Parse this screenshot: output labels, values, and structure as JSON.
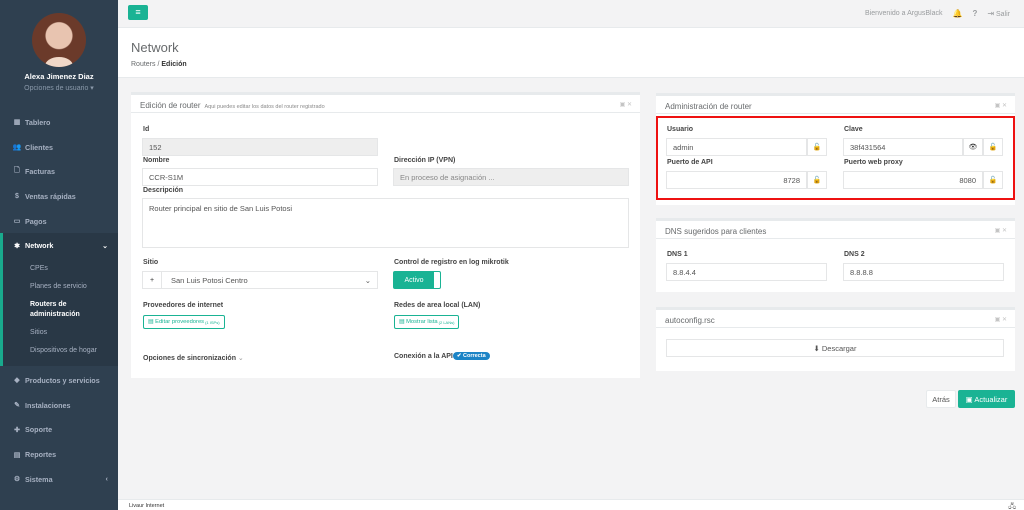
{
  "user": {
    "name": "Alexa Jimenez Diaz",
    "options": "Opciones de usuario ▾"
  },
  "nav": [
    {
      "label": "Tablero",
      "icon": "▦"
    },
    {
      "label": "Clientes",
      "icon": "👥"
    },
    {
      "label": "Facturas",
      "icon": "🗋"
    },
    {
      "label": "Ventas rápidas",
      "icon": "$"
    },
    {
      "label": "Pagos",
      "icon": "▭"
    },
    {
      "label": "Network",
      "icon": "✱",
      "chevron": "⌄"
    },
    {
      "label": "Productos y servicios",
      "icon": "◆"
    },
    {
      "label": "Instalaciones",
      "icon": "✎"
    },
    {
      "label": "Soporte",
      "icon": "✚"
    },
    {
      "label": "Reportes",
      "icon": "▤"
    },
    {
      "label": "Sistema",
      "icon": "⚙",
      "chevron": "‹"
    }
  ],
  "subnav": [
    "CPEs",
    "Planes de servicio",
    "Routers de administración",
    "Sitios",
    "Dispositivos de hogar"
  ],
  "topbar": {
    "menu_icon": "≡",
    "welcome": "Bienvenido a ArgusBlack",
    "bell": "🔔",
    "help": "?",
    "exit_icon": "⇥",
    "exit": "Salir"
  },
  "page": {
    "title": "Network",
    "crumb1": "Routers",
    "crumb_sep": "/",
    "crumb2": "Edición"
  },
  "edit": {
    "title": "Edición de router",
    "subtitle": "Aqui puedes editar los datos del router registrado",
    "tools": "▣ ✕",
    "id_label": "Id",
    "id_value": "152",
    "name_label": "Nombre",
    "name_value": "CCR-S1M",
    "ip_label": "Dirección IP (VPN)",
    "ip_value": "En proceso de asignación ...",
    "desc_label": "Descripción",
    "desc_value": "Router principal en sitio de San Luis Potosi",
    "site_label": "Sitio",
    "site_add": "+",
    "site_value": "San Luis Potosi Centro",
    "site_caret": "⌄",
    "log_label": "Control de registro en log mikrotik",
    "log_value": "Activo",
    "isp_label": "Proveedores de internet",
    "isp_button": "▤ Editar proveedores",
    "isp_count": "(1 ISPs)",
    "lan_label": "Redes de area local (LAN)",
    "lan_button": "▤ Mostrar lista",
    "lan_count": "(2 LANs)",
    "sync_label": "Opciones de sincronización",
    "sync_caret": "⌄",
    "api_label": "Conexión a la API",
    "api_status": "✔ Correcta"
  },
  "admin": {
    "title": "Administración de router",
    "tools": "▣ ✕",
    "user_label": "Usuario",
    "user_value": "admin",
    "pass_label": "Clave",
    "pass_value": "38f431564",
    "api_label": "Puerto de API",
    "api_value": "8728",
    "proxy_label": "Puerto web proxy",
    "proxy_value": "8080",
    "lock": "🔓",
    "eye": "👁"
  },
  "dns": {
    "title": "DNS sugeridos para clientes",
    "tools": "▣ ✕",
    "dns1_label": "DNS 1",
    "dns1_value": "8.8.4.4",
    "dns2_label": "DNS 2",
    "dns2_value": "8.8.8.8"
  },
  "autoconfig": {
    "title": "autoconfig.rsc",
    "tools": "▣ ✕",
    "download": "⬇ Descargar"
  },
  "actions": {
    "back": "Atrás",
    "update": "▣ Actualizar"
  },
  "footer": {
    "text": "Livaur Internet",
    "icon": "🖧"
  }
}
